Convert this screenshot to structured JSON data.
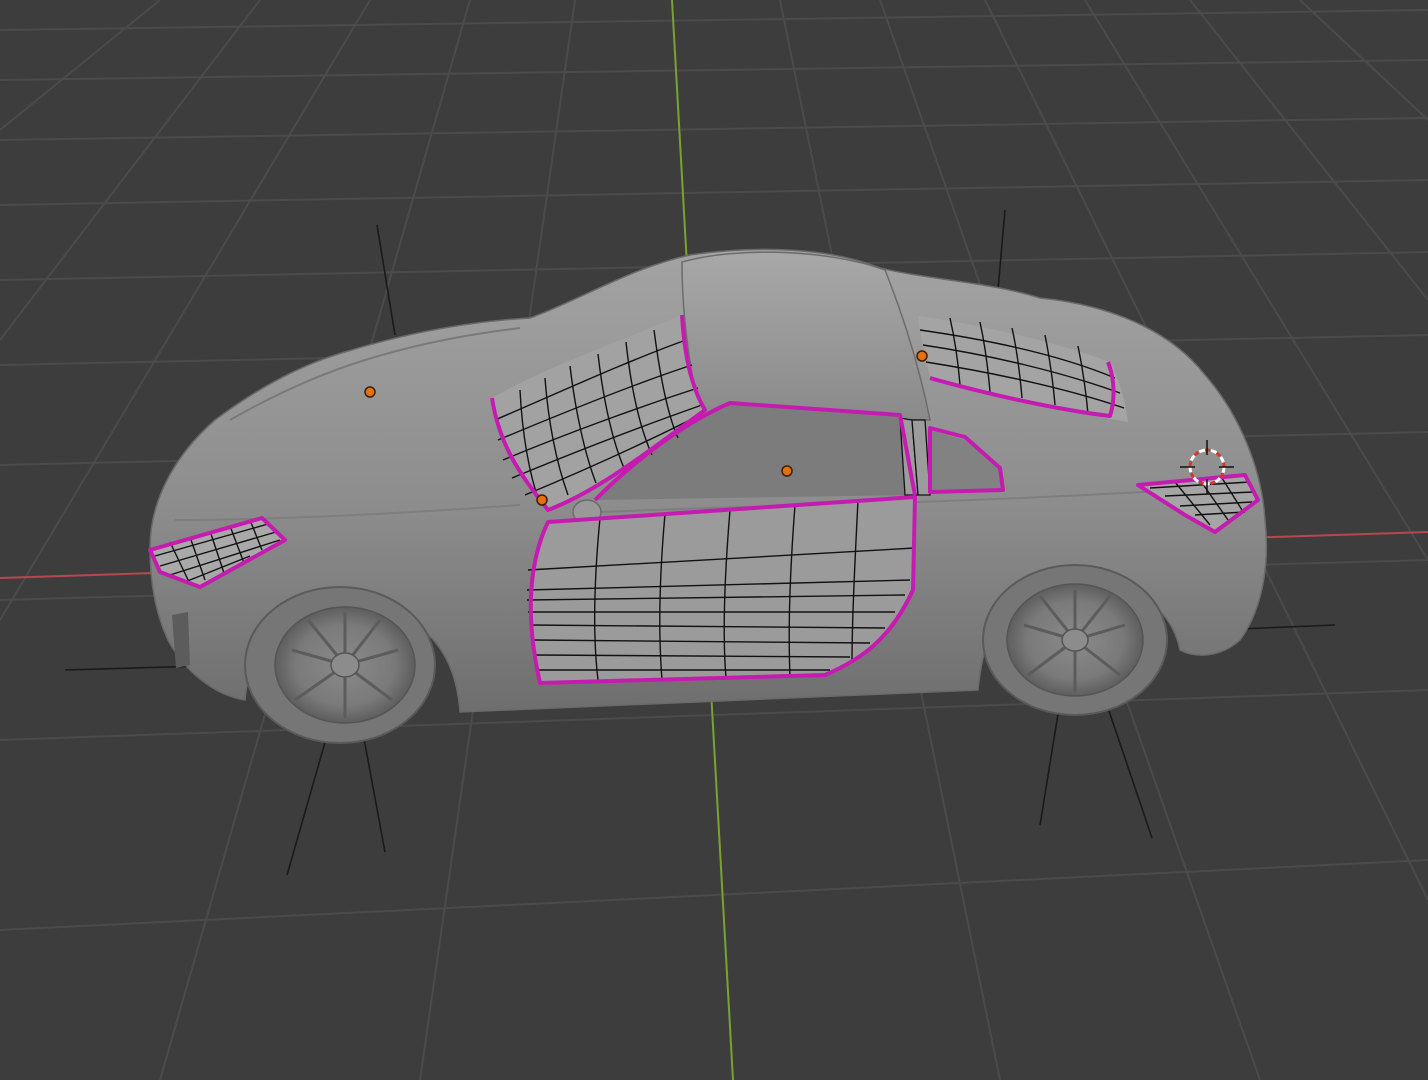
{
  "viewport": {
    "background": "#3d3d3d",
    "grid_color": "#4b4b4b",
    "x_axis_color": "#b8474f",
    "y_axis_color": "#7aa22e",
    "selection_outline_color": "#c51bb1",
    "origin_dot_color": "#e5700f",
    "model_color": "#8f8f8f"
  },
  "scene": {
    "object": "car",
    "selected_parts": [
      "headlight-left",
      "windshield",
      "side-window",
      "door",
      "rear-window",
      "taillight"
    ],
    "origin_markers": 4,
    "cursor_icon": "3d-cursor-icon"
  }
}
